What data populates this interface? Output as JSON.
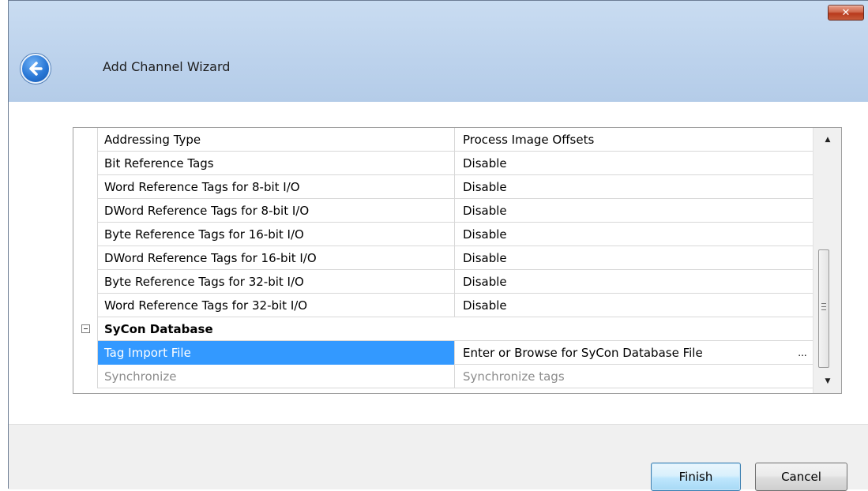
{
  "window": {
    "title": "Add Channel Wizard",
    "close_label": "✕",
    "back_icon": "back-arrow-icon"
  },
  "properties": {
    "rows": [
      {
        "name": "Addressing Type",
        "value": "Process Image Offsets"
      },
      {
        "name": "Bit Reference Tags",
        "value": "Disable"
      },
      {
        "name": "Word Reference Tags for 8-bit I/O",
        "value": "Disable"
      },
      {
        "name": "DWord Reference Tags for 8-bit I/O",
        "value": "Disable"
      },
      {
        "name": "Byte Reference Tags for 16-bit I/O",
        "value": "Disable"
      },
      {
        "name": "DWord Reference Tags for 16-bit I/O",
        "value": "Disable"
      },
      {
        "name": "Byte Reference Tags for 32-bit I/O",
        "value": "Disable"
      },
      {
        "name": "Word Reference Tags for 32-bit I/O",
        "value": "Disable"
      }
    ],
    "category": {
      "label": "SyCon Database",
      "expander": "⊟"
    },
    "tag_import": {
      "name": "Tag Import File",
      "value": "Enter or Browse for SyCon Database File",
      "browse": "..."
    },
    "synchronize": {
      "name": "Synchronize",
      "value": "Synchronize tags"
    }
  },
  "scrollbar": {
    "up": "▲",
    "down": "▼"
  },
  "buttons": {
    "finish": "Finish",
    "cancel": "Cancel"
  }
}
